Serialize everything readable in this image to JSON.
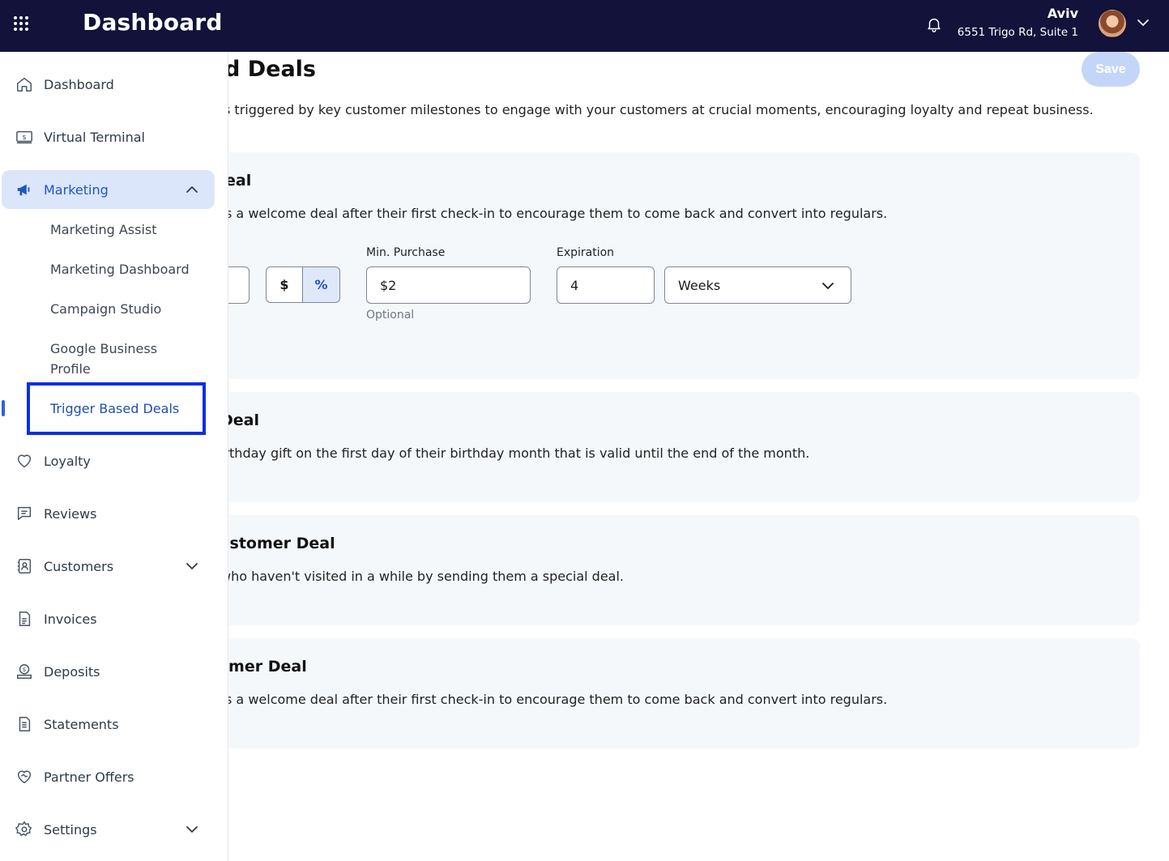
{
  "header": {
    "app_title": "Dashboard",
    "user_name": "Aviv",
    "user_address": "6551 Trigo Rd, Suite 1"
  },
  "sidebar": {
    "items": [
      {
        "label": "Dashboard",
        "icon": "home-icon"
      },
      {
        "label": "Virtual Terminal",
        "icon": "terminal-icon"
      },
      {
        "label": "Marketing",
        "icon": "megaphone-icon",
        "expanded": true
      },
      {
        "label": "Loyalty",
        "icon": "heart-icon"
      },
      {
        "label": "Reviews",
        "icon": "reviews-icon"
      },
      {
        "label": "Customers",
        "icon": "customers-icon"
      },
      {
        "label": "Invoices",
        "icon": "invoice-icon"
      },
      {
        "label": "Deposits",
        "icon": "deposit-icon"
      },
      {
        "label": "Statements",
        "icon": "statement-icon"
      },
      {
        "label": "Partner Offers",
        "icon": "handshake-icon"
      },
      {
        "label": "Settings",
        "icon": "gear-icon"
      }
    ],
    "marketing_sub": [
      "Marketing Assist",
      "Marketing Dashboard",
      "Campaign Studio",
      "Google Business Profile",
      "Trigger Based Deals"
    ]
  },
  "main": {
    "title": "d Deals",
    "subtitle": "s triggered by key customer milestones to engage with your customers at crucial moments, encouraging loyalty and repeat business.",
    "save_label": "Save",
    "cards": [
      {
        "title": "eal",
        "desc": "s a welcome deal after their first check-in to encourage them to come back and convert into regulars.",
        "form": {
          "discount_type_dollar": "$",
          "discount_type_percent": "%",
          "min_purchase_label": "Min. Purchase",
          "min_purchase_value": "$2",
          "min_purchase_hint": "Optional",
          "expiration_label": "Expiration",
          "expiration_value": "4",
          "expiration_unit": "Weeks"
        }
      },
      {
        "title": "Deal",
        "desc": "irthday gift on the first day of their birthday month that is valid until the end of the month."
      },
      {
        "title": "ustomer Deal",
        "desc": " who haven't visited in a while by sending them a special deal."
      },
      {
        "title": "omer Deal",
        "desc": "s a welcome deal after their first check-in to encourage them to come back and convert into regulars."
      }
    ]
  },
  "colors": {
    "topbar": "#12123a",
    "accent": "#1f55c4",
    "active_bg": "#dce6fb",
    "card_bg": "#f5f8fb",
    "highlight_box": "#0a2ee6"
  }
}
